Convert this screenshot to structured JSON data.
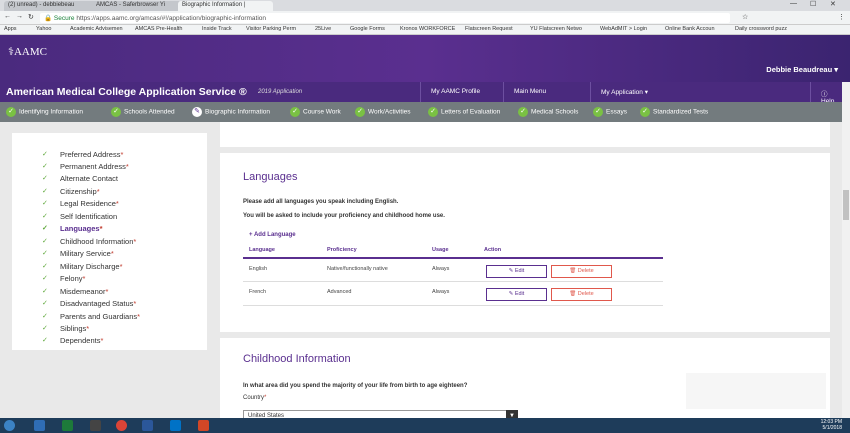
{
  "browser": {
    "tabs": [
      "(2) unread) - debbiebeau",
      "AMCAS - Saferbrowser Yi",
      "Biographic Information |"
    ],
    "url_prefix": "Secure",
    "url": "https://apps.aamc.org/amcas/#!/application/biographic-information",
    "bookmarks": [
      "Apps",
      "Yahoo",
      "Academic Advisemen",
      "AMCAS Pre-Health",
      "Inside Track",
      "Visitor Parking Perm",
      "25Live",
      "Google Forms",
      "Kronos WORKFORCE",
      "Flatscreen Request",
      "YU Flatscreen Netwo",
      "WebAdMIT > Login",
      "Online Bank Accoun",
      "Daily crossword puzz"
    ]
  },
  "header": {
    "logo": "AAMC",
    "user": "Debbie Beaudreau ▾",
    "app_title": "American Medical College Application Service ®",
    "app_year": "2019 Application",
    "nav": [
      "My AAMC Profile",
      "Main Menu",
      "My Application ▾",
      "Help"
    ]
  },
  "progress": [
    "Identifying Information",
    "Schools Attended",
    "Biographic Information",
    "Course Work",
    "Work/Activities",
    "Letters of Evaluation",
    "Medical Schools",
    "Essays",
    "Standardized Tests"
  ],
  "sidebar": [
    {
      "label": "Preferred Address",
      "req": "*"
    },
    {
      "label": "Permanent Address",
      "req": "*"
    },
    {
      "label": "Alternate Contact",
      "req": ""
    },
    {
      "label": "Citizenship",
      "req": "*"
    },
    {
      "label": "Legal Residence",
      "req": "*"
    },
    {
      "label": "Self Identification",
      "req": ""
    },
    {
      "label": "Languages",
      "req": "*"
    },
    {
      "label": "Childhood Information",
      "req": "*"
    },
    {
      "label": "Military Service",
      "req": "*"
    },
    {
      "label": "Military Discharge",
      "req": "*"
    },
    {
      "label": "Felony",
      "req": "*"
    },
    {
      "label": "Misdemeanor",
      "req": "*"
    },
    {
      "label": "Disadvantaged Status",
      "req": "*"
    },
    {
      "label": "Parents and Guardians",
      "req": "*"
    },
    {
      "label": "Siblings",
      "req": "*"
    },
    {
      "label": "Dependents",
      "req": "*"
    }
  ],
  "languages": {
    "heading": "Languages",
    "line1": "Please add all languages you speak including English.",
    "line2": "You will be asked to include your proficiency and childhood home use.",
    "add": "+ Add Language",
    "columns": [
      "Language",
      "Proficiency",
      "Usage",
      "Action"
    ],
    "rows": [
      {
        "language": "English",
        "proficiency": "Native/functionally native",
        "usage": "Always"
      },
      {
        "language": "French",
        "proficiency": "Advanced",
        "usage": "Always"
      }
    ],
    "edit": "✎ Edit",
    "delete": "🗑 Delete"
  },
  "childhood": {
    "heading": "Childhood Information",
    "question": "In what area did you spend the majority of your life from birth to age eighteen?",
    "country_label": "Country",
    "country_value": "United States"
  },
  "taskbar": {
    "time": "12:03 PM",
    "date": "5/1/2018"
  }
}
